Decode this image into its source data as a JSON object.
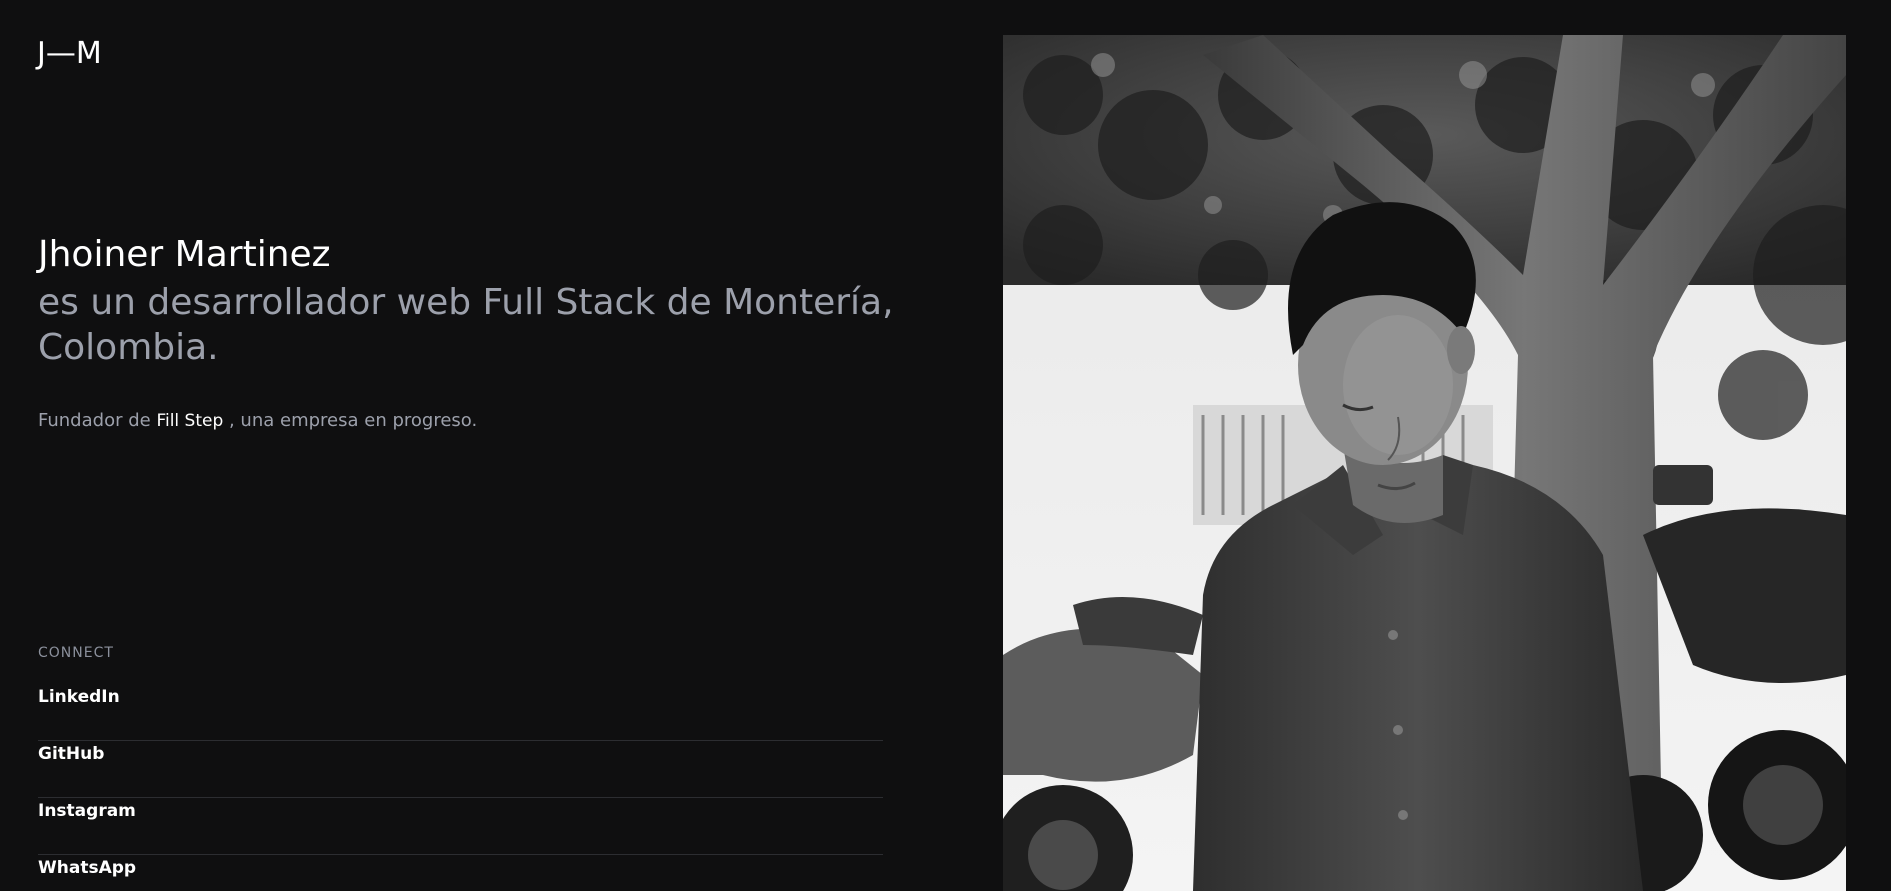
{
  "logo": "J—M",
  "intro": {
    "name": "Jhoiner Martinez",
    "tagline": "es un desarrollador web Full Stack de Montería, Colombia.",
    "founder_prefix": "Fundador de ",
    "company": "Fill Step",
    "founder_suffix": " , una empresa en progreso."
  },
  "connect": {
    "heading": "CONNECT",
    "links": [
      {
        "label": "LinkedIn"
      },
      {
        "label": "GitHub"
      },
      {
        "label": "Instagram"
      },
      {
        "label": "WhatsApp"
      }
    ]
  },
  "photo": {
    "subject": "black-and-white portrait of a young man under a tree beside parked motorcycles"
  }
}
